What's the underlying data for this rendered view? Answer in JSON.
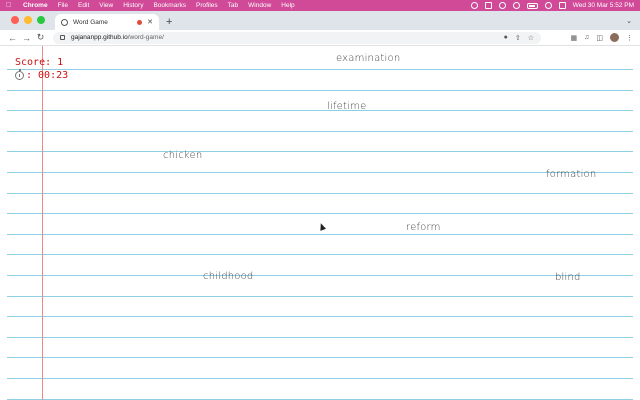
{
  "menubar": {
    "items": [
      "Chrome",
      "File",
      "Edit",
      "View",
      "History",
      "Bookmarks",
      "Profiles",
      "Tab",
      "Window",
      "Help"
    ],
    "datetime": "Wed 30 Mar  5:52 PM"
  },
  "browser": {
    "tab_title": "Word Game",
    "url_host": "gajananpp.github.io",
    "url_path": "/word-game/"
  },
  "game": {
    "score_label": "Score: 1",
    "timer_label": ": 00:23",
    "words": [
      "examination",
      "lifetime",
      "chicken",
      "formation",
      "reform",
      "childhood",
      "blind"
    ]
  },
  "colors": {
    "menubar": "#d04a98",
    "rule_line": "#8fcfe4",
    "margin_line": "#ea8a8a",
    "score_text": "#cc1111"
  }
}
